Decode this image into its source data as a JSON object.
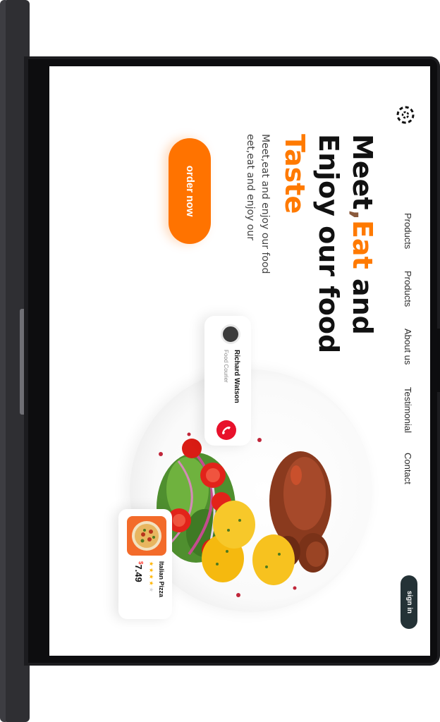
{
  "nav": {
    "items": [
      "Products",
      "Products",
      "About us",
      "Testimonial",
      "Contact"
    ],
    "signin_label": "sign in"
  },
  "hero": {
    "title_word1": "Meet",
    "title_comma": ",",
    "title_word2": "Eat",
    "title_word3": " and",
    "title_line2": "Enjoy our food",
    "title_line3": "Taste",
    "subtitle": "Meet,eat and enjoy our food eet,eat and enjoy our",
    "order_label": "order now"
  },
  "courier": {
    "name": "Richard Watson",
    "role": "Food Courier"
  },
  "product": {
    "name": "Italian Pizza",
    "rating": 4,
    "rating_max": 5,
    "currency": "$",
    "price": "7.49"
  },
  "icons": {
    "logo": "brand-logo-icon",
    "call": "phone-icon",
    "star": "star-icon"
  },
  "colors": {
    "accent": "#ff7300",
    "signin_bg": "#243236",
    "call_red": "#e8112b",
    "star": "#ffb400"
  }
}
